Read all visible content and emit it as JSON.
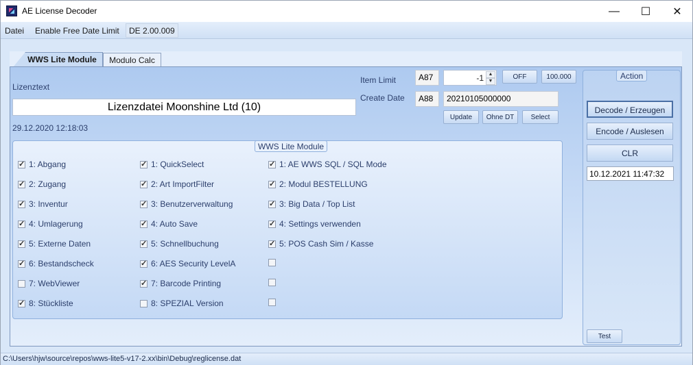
{
  "window": {
    "title": "AE License Decoder",
    "minimize": "—",
    "maximize": "☐",
    "close": "✕"
  },
  "menu": {
    "file": "Datei",
    "free_date": "Enable Free Date Limit",
    "version": "DE 2.00.009"
  },
  "tabs": [
    {
      "label": "WWS Lite Module"
    },
    {
      "label": "Modulo Calc"
    }
  ],
  "license": {
    "label": "Lizenztext",
    "value": "Lizenzdatei Moonshine Ltd (10)",
    "timestamp": "29.12.2020 12:18:03"
  },
  "item_limit": {
    "label": "Item Limit",
    "code": "A87",
    "value": "-1",
    "off_btn": "OFF",
    "preset_btn": "100.000"
  },
  "create_date": {
    "label": "Create Date",
    "code": "A88",
    "value": "20210105000000"
  },
  "buttons": {
    "update": "Update",
    "ohne_dt": "Ohne DT",
    "select": "Select"
  },
  "modules": {
    "title": "WWS Lite Module",
    "col1": [
      {
        "label": "1: Abgang",
        "checked": true
      },
      {
        "label": "2: Zugang",
        "checked": true
      },
      {
        "label": "3: Inventur",
        "checked": true
      },
      {
        "label": "4: Umlagerung",
        "checked": true
      },
      {
        "label": "5: Externe Daten",
        "checked": true
      },
      {
        "label": "6: Bestandscheck",
        "checked": true
      },
      {
        "label": "7: WebViewer",
        "checked": false
      },
      {
        "label": "8: Stückliste",
        "checked": true
      }
    ],
    "col2": [
      {
        "label": "1: QuickSelect",
        "checked": true
      },
      {
        "label": "2: Art ImportFilter",
        "checked": true
      },
      {
        "label": "3: Benutzerverwaltung",
        "checked": true
      },
      {
        "label": "4: Auto Save",
        "checked": true
      },
      {
        "label": "5: Schnellbuchung",
        "checked": true
      },
      {
        "label": "6: AES Security LevelA",
        "checked": true
      },
      {
        "label": "7: Barcode Printing",
        "checked": true
      },
      {
        "label": "8: SPEZIAL Version",
        "checked": false
      }
    ],
    "col3": [
      {
        "label": "1: AE WWS SQL / SQL Mode",
        "checked": true
      },
      {
        "label": "2: Modul BESTELLUNG",
        "checked": true
      },
      {
        "label": "3: Big Data / Top List",
        "checked": true
      },
      {
        "label": "4: Settings verwenden",
        "checked": true
      },
      {
        "label": " 5: POS Cash Sim / Kasse",
        "checked": true
      },
      {
        "label": "",
        "checked": false
      },
      {
        "label": "",
        "checked": false
      },
      {
        "label": "",
        "checked": false
      }
    ]
  },
  "action": {
    "title": "Action",
    "decode": "Decode / Erzeugen",
    "encode": "Encode / Auslesen",
    "clr": "CLR",
    "date": "10.12.2021 11:47:32",
    "test": "Test"
  },
  "status": {
    "path": "C:\\Users\\hjw\\source\\repos\\wws-lite5-v17-2.xx\\bin\\Debug\\reglicense.dat"
  }
}
